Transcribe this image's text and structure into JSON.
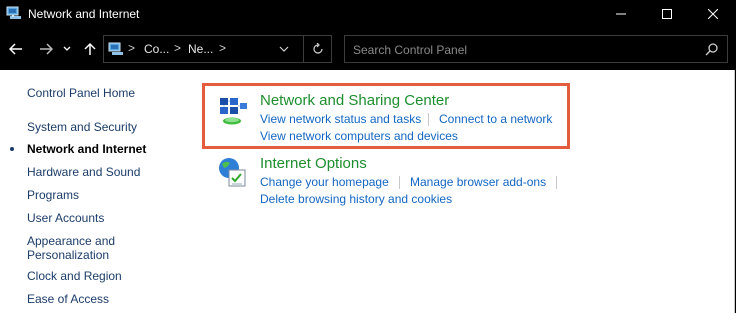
{
  "window": {
    "title": "Network and Internet"
  },
  "titlebar": {
    "minimize": "—",
    "maximize": "☐",
    "close": "✕"
  },
  "address": {
    "crumbs": [
      "Co...",
      "Ne..."
    ],
    "separator": ">"
  },
  "search": {
    "placeholder": "Search Control Panel"
  },
  "sidebar": {
    "items": [
      {
        "label": "Control Panel Home",
        "active": false
      },
      {
        "label": "System and Security",
        "active": false
      },
      {
        "label": "Network and Internet",
        "active": true
      },
      {
        "label": "Hardware and Sound",
        "active": false
      },
      {
        "label": "Programs",
        "active": false
      },
      {
        "label": "User Accounts",
        "active": false
      },
      {
        "label": "Appearance and Personalization",
        "active": false
      },
      {
        "label": "Clock and Region",
        "active": false
      },
      {
        "label": "Ease of Access",
        "active": false
      }
    ]
  },
  "categories": [
    {
      "title": "Network and Sharing Center",
      "icon": "network-sharing-center-icon",
      "links": [
        "View network status and tasks",
        "Connect to a network",
        "View network computers and devices"
      ]
    },
    {
      "title": "Internet Options",
      "icon": "internet-options-icon",
      "links": [
        "Change your homepage",
        "Manage browser add-ons",
        "Delete browsing history and cookies"
      ]
    }
  ],
  "colors": {
    "accent_highlight": "#e35c3b",
    "category_title": "#1e8e2e",
    "link": "#1366c2",
    "sidebar_link": "#1c3c68"
  }
}
